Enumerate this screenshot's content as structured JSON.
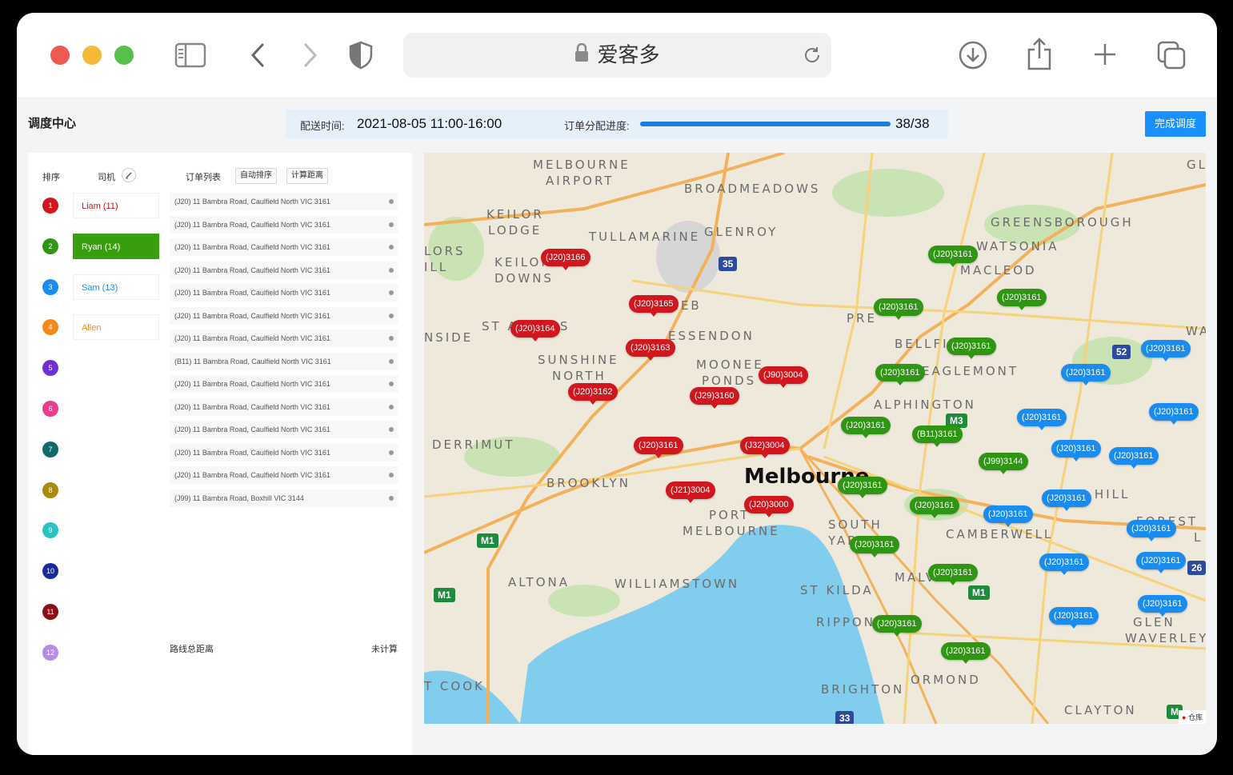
{
  "browser": {
    "url_title": "爱客多"
  },
  "app": {
    "title": "调度中心",
    "delivery_time_label": "配送时间:",
    "delivery_time_value": "2021-08-05 11:00-16:00",
    "progress_label": "订单分配进度:",
    "progress_text": "38/38",
    "progress_fraction": 1.0,
    "finish_button": "完成调度"
  },
  "table": {
    "col_seq": "排序",
    "col_driver": "司机",
    "col_orders": "订单列表",
    "auto_sort_button": "自动排序",
    "calc_distance_button": "计算距离",
    "sequence": [
      {
        "n": "1",
        "color": "#d0171e"
      },
      {
        "n": "2",
        "color": "#2e9612"
      },
      {
        "n": "3",
        "color": "#1a8cf0"
      },
      {
        "n": "4",
        "color": "#f28a1b"
      },
      {
        "n": "5",
        "color": "#6f2fd6"
      },
      {
        "n": "6",
        "color": "#ea3d8f"
      },
      {
        "n": "7",
        "color": "#0f6a6a"
      },
      {
        "n": "8",
        "color": "#a98a0c"
      },
      {
        "n": "9",
        "color": "#2ac3c3"
      },
      {
        "n": "10",
        "color": "#1a2a9c"
      },
      {
        "n": "11",
        "color": "#8c0f16"
      },
      {
        "n": "12",
        "color": "#b58ae8"
      }
    ],
    "drivers": [
      {
        "name": "Liam (11)",
        "color": "#d0171e",
        "active": false
      },
      {
        "name": "Ryan (14)",
        "color": "#ffffff",
        "active": true
      },
      {
        "name": "Sam (13)",
        "color": "#1a8cf0",
        "active": false
      },
      {
        "name": "Allen",
        "color": "#f28a1b",
        "active": false
      }
    ],
    "orders": [
      "(J20) 11 Bambra Road, Caulfield North VIC 3161",
      "(J20) 11 Bambra Road, Caulfield North VIC 3161",
      "(J20) 11 Bambra Road, Caulfield North VIC 3161",
      "(J20) 11 Bambra Road, Caulfield North VIC 3161",
      "(J20) 11 Bambra Road, Caulfield North VIC 3161",
      "(J20) 11 Bambra Road, Caulfield North VIC 3161",
      "(J20) 11 Bambra Road, Caulfield North VIC 3161",
      "(B11) 11 Bambra Road, Caulfield North VIC 3161",
      "(J20) 11 Bambra Road, Caulfield North VIC 3161",
      "(J20) 11 Bambra Road, Caulfield North VIC 3161",
      "(J20) 11 Bambra Road, Caulfield North VIC 3161",
      "(J20) 11 Bambra Road, Caulfield North VIC 3161",
      "(J20) 11 Bambra Road, Caulfield North VIC 3161",
      "(J99) 11 Bambra Road, Boxhill VIC 3144"
    ],
    "total_distance_label": "路线总距离",
    "total_distance_value": "未计算"
  },
  "map": {
    "places": [
      "MELBOURNE",
      "AIRPORT",
      "BROADMEADOWS",
      "GL",
      "KEILOR",
      "LODGE",
      "TULLAMARINE",
      "GLENROY",
      "GREENSBOROUGH",
      "WATSONIA",
      "LORS",
      "ILL",
      "KEILOR",
      "DOWNS",
      "MACLEOD",
      "MEB",
      "ST ALBANS",
      "PRE",
      "NSIDE",
      "ESSENDON",
      "BELLFIELD",
      "WA",
      "SUNSHINE",
      "NORTH",
      "MOONEE",
      "PONDS",
      "EAGLEMONT",
      "ALPHINGTON",
      "DERRIMUT",
      "Melbourne",
      "BROOKLYN",
      "BOX HILL",
      "PORT",
      "MELBOURNE",
      "SOUTH",
      "YARRA",
      "CAMBERWELL",
      "FOREST",
      "L",
      "ALTONA",
      "WILLIAMSTOWN",
      "MALVERN",
      "ST KILDA",
      "RIPPONLEA",
      "GLEN",
      "WAVERLEY",
      "T COOK",
      "BRIGHTON",
      "ORMOND",
      "CLAYTON"
    ],
    "shields": [
      "35",
      "52",
      "M3",
      "M1",
      "M1",
      "M1",
      "26",
      "33",
      "M"
    ],
    "pins": [
      {
        "label": "(J20)3166",
        "color": "red"
      },
      {
        "label": "(J20)3165",
        "color": "red"
      },
      {
        "label": "(J20)3164",
        "color": "red"
      },
      {
        "label": "(J20)3163",
        "color": "red"
      },
      {
        "label": "(J90)3004",
        "color": "red"
      },
      {
        "label": "(J20)3162",
        "color": "red"
      },
      {
        "label": "(J29)3160",
        "color": "red"
      },
      {
        "label": "(J20)3161",
        "color": "red"
      },
      {
        "label": "(J32)3004",
        "color": "red"
      },
      {
        "label": "(J21)3004",
        "color": "red"
      },
      {
        "label": "(J20)3000",
        "color": "red"
      },
      {
        "label": "(J20)3161",
        "color": "green"
      },
      {
        "label": "(J20)3161",
        "color": "green"
      },
      {
        "label": "(J20)3161",
        "color": "green"
      },
      {
        "label": "(J20)3161",
        "color": "green"
      },
      {
        "label": "(J20)3161",
        "color": "green"
      },
      {
        "label": "(J20)3161",
        "color": "green"
      },
      {
        "label": "(B11)3161",
        "color": "green"
      },
      {
        "label": "(J99)3144",
        "color": "green"
      },
      {
        "label": "(J20)3161",
        "color": "green"
      },
      {
        "label": "(J20)3161",
        "color": "green"
      },
      {
        "label": "(J20)3161",
        "color": "green"
      },
      {
        "label": "(J20)3161",
        "color": "green"
      },
      {
        "label": "(J20)3161",
        "color": "green"
      },
      {
        "label": "(J20)3161",
        "color": "green"
      },
      {
        "label": "(J20)3161",
        "color": "blue"
      },
      {
        "label": "(J20)3161",
        "color": "blue"
      },
      {
        "label": "(J20)3161",
        "color": "blue"
      },
      {
        "label": "(J20)3161",
        "color": "blue"
      },
      {
        "label": "(J20)3161",
        "color": "blue"
      },
      {
        "label": "(J20)3161",
        "color": "blue"
      },
      {
        "label": "(J20)3161",
        "color": "blue"
      },
      {
        "label": "(J20)3161",
        "color": "blue"
      },
      {
        "label": "(J20)3161",
        "color": "blue"
      },
      {
        "label": "(J20)3161",
        "color": "blue"
      },
      {
        "label": "(J20)3161",
        "color": "blue"
      },
      {
        "label": "(J20)3161",
        "color": "blue"
      },
      {
        "label": "(J20)3161",
        "color": "blue"
      }
    ],
    "attribution": "仓库"
  }
}
